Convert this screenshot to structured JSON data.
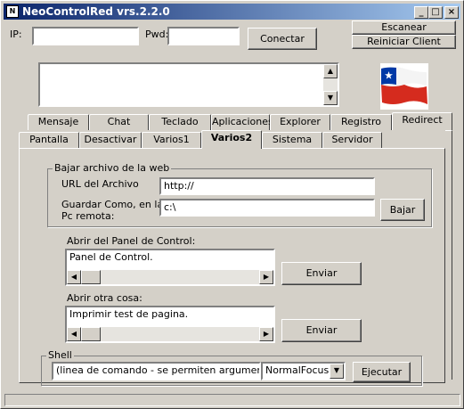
{
  "window": {
    "title": "NeoControlRed vrs.2.2.0",
    "icon_label": "N"
  },
  "titlebar_buttons": {
    "minimize": "_",
    "maximize": "□",
    "close": "×"
  },
  "connection": {
    "ip_label": "IP:",
    "ip_value": "",
    "pwd_label": "Pwd:",
    "pwd_value": "",
    "connect_label": "Conectar",
    "scan_label": "Escanear",
    "restart_label": "Reiniciar Client"
  },
  "flag": {
    "name": "Chile",
    "colors": {
      "blue": "#0039a6",
      "white": "#ffffff",
      "red": "#d52b1e"
    }
  },
  "tabs_row1": [
    "Mensaje",
    "Chat",
    "Teclado",
    "Aplicaciones",
    "Explorer",
    "Registro",
    "Redirect"
  ],
  "tabs_row2": [
    "Pantalla",
    "Desactivar",
    "Varios1",
    "Varios2",
    "Sistema",
    "Servidor"
  ],
  "active_tab": "Varios2",
  "download": {
    "group_title": "Bajar archivo de la web",
    "url_label": "URL del Archivo",
    "url_value": "http://",
    "save_label_line1": "Guardar Como, en la",
    "save_label_line2": "Pc remota:",
    "save_value": "c:\\",
    "download_button": "Bajar"
  },
  "control_panel": {
    "label": "Abrir del Panel de Control:",
    "value": "Panel de Control.",
    "send_button": "Enviar"
  },
  "other": {
    "label": "Abrir otra cosa:",
    "value": "Imprimir test de pagina.",
    "send_button": "Enviar"
  },
  "shell": {
    "group_title": "Shell",
    "command_value": "(linea de comando - se permiten argumentos)",
    "focus_selected": "NormalFocus",
    "execute_button": "Ejecutar"
  },
  "colors": {
    "titlebar_start": "#0a246a",
    "titlebar_end": "#a6caf0",
    "face": "#d4d0c8"
  }
}
